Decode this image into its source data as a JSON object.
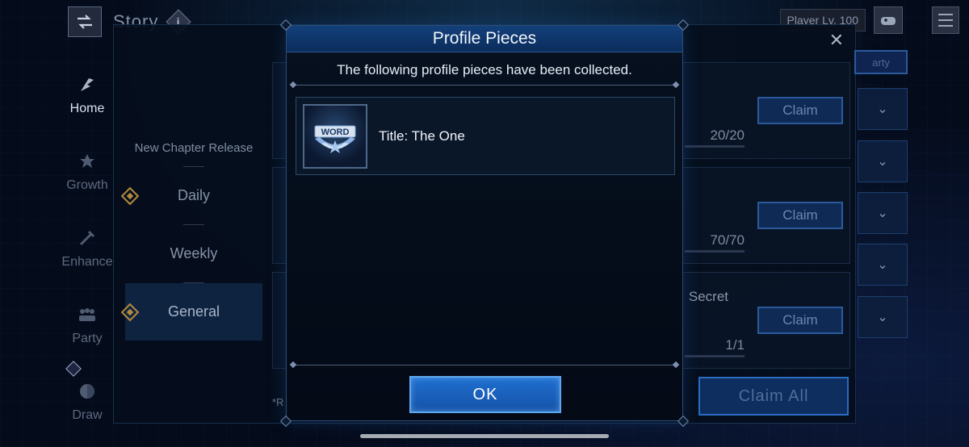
{
  "top_bar": {
    "screen_title": "Story",
    "info_label": "i",
    "player_level": "Player Lv. 100"
  },
  "left_nav": [
    {
      "label": "Home",
      "icon": "home-icon",
      "active": true
    },
    {
      "label": "Growth",
      "icon": "growth-icon",
      "active": false
    },
    {
      "label": "Enhance",
      "icon": "enhance-icon",
      "active": false
    },
    {
      "label": "Party",
      "icon": "party-icon",
      "active": false
    },
    {
      "label": "Draw",
      "icon": "draw-icon",
      "active": false
    }
  ],
  "mission_dialog": {
    "categories": [
      {
        "label": "New Chapter Release"
      },
      {
        "label": "Daily"
      },
      {
        "label": "Weekly"
      },
      {
        "label": "General"
      }
    ],
    "cards": [
      {
        "claim_label": "Claim",
        "progress": "20/20",
        "extra": ""
      },
      {
        "claim_label": "Claim",
        "progress": "70/70",
        "extra": ""
      },
      {
        "claim_label": "Claim",
        "progress": "1/1",
        "extra": "Secret"
      }
    ],
    "party_label": "arty",
    "claim_all_label": "Claim All",
    "footnote": "*R"
  },
  "modal": {
    "title": "Profile Pieces",
    "subtitle": "The following profile pieces have been collected.",
    "pieces": [
      {
        "icon_text": "WORD",
        "label": "Title: The One"
      }
    ],
    "ok_label": "OK"
  },
  "colors": {
    "accent": "#1f6fd0",
    "header": "#13407a",
    "gold_diamond": "#b48a3e"
  }
}
